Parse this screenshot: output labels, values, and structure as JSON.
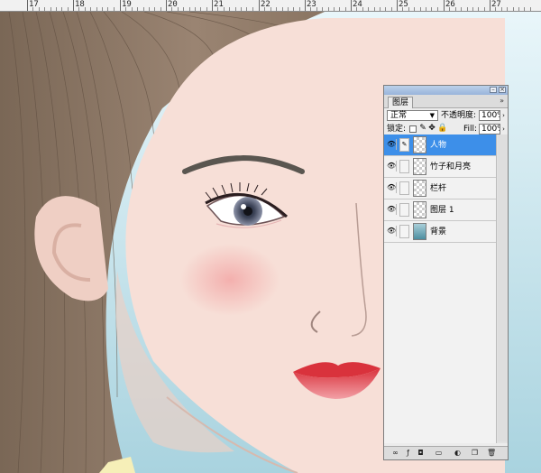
{
  "ruler": {
    "numbers": [
      "17",
      "18",
      "19",
      "20",
      "21",
      "22",
      "23",
      "24",
      "25",
      "26",
      "27"
    ]
  },
  "layers_panel": {
    "tab_label": "图层",
    "menu_label": "»",
    "blend_mode": "正常",
    "opacity_label": "不透明度:",
    "opacity_value": "100%",
    "lock_label": "锁定:",
    "fill_label": "Fill:",
    "fill_value": "100%",
    "layers": [
      {
        "name": "人物",
        "selected": true
      },
      {
        "name": "竹子和月亮",
        "selected": false
      },
      {
        "name": "栏杆",
        "selected": false
      },
      {
        "name": "图层 1",
        "selected": false
      },
      {
        "name": "背景",
        "selected": false
      }
    ],
    "selected_color": "#3d8fe9"
  },
  "icons": [
    "eye-icon",
    "brush-icon",
    "lock-transparent-icon",
    "lock-paint-icon",
    "lock-move-icon",
    "lock-all-icon",
    "link-layers-icon",
    "add-style-icon",
    "add-mask-icon",
    "new-group-icon",
    "adjustment-layer-icon",
    "new-layer-icon",
    "trash-icon"
  ]
}
